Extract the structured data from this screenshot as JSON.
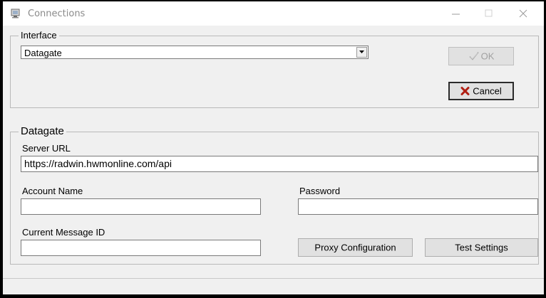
{
  "window": {
    "title": "Connections"
  },
  "interface_group": {
    "legend": "Interface",
    "selected": "Datagate",
    "ok_label": "OK",
    "cancel_label": "Cancel"
  },
  "datagate_group": {
    "legend": "Datagate",
    "server_url_label": "Server URL",
    "server_url_value": "https://radwin.hwmonline.com/api",
    "account_label": "Account Name",
    "account_value": "",
    "password_label": "Password",
    "password_value": "",
    "msgid_label": "Current Message ID",
    "msgid_value": "",
    "proxy_label": "Proxy Configuration",
    "test_label": "Test Settings"
  },
  "icons": [
    "app-icon",
    "minimize-icon",
    "maximize-icon",
    "close-icon",
    "dropdown-arrow-icon",
    "checkmark-icon",
    "x-icon"
  ]
}
